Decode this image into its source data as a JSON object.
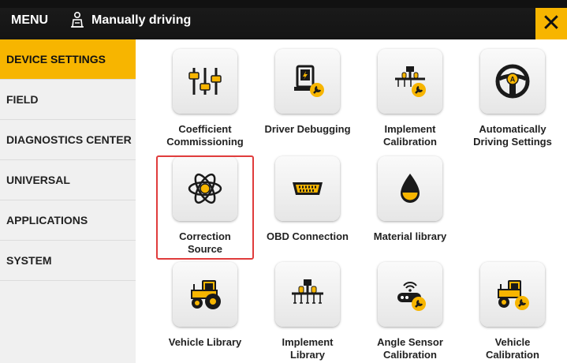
{
  "header": {
    "menu_label": "MENU",
    "mode_icon": "tractor-driver-icon",
    "mode_label": "Manually driving",
    "close_icon": "close-icon",
    "close_glyph": "✕"
  },
  "sidebar": {
    "items": [
      {
        "label": "DEVICE SETTINGS",
        "active": true
      },
      {
        "label": "FIELD",
        "active": false
      },
      {
        "label": "DIAGNOSTICS CENTER",
        "active": false
      },
      {
        "label": "UNIVERSAL",
        "active": false
      },
      {
        "label": "APPLICATIONS",
        "active": false
      },
      {
        "label": "SYSTEM",
        "active": false
      }
    ]
  },
  "tiles": [
    {
      "label": "Coefficient\nCommissioning",
      "icon": "sliders-icon"
    },
    {
      "label": "Driver Debugging",
      "icon": "driver-device-icon"
    },
    {
      "label": "Implement\nCalibration",
      "icon": "implement-calibration-icon"
    },
    {
      "label": "Automatically\nDriving Settings",
      "icon": "steering-wheel-icon"
    },
    {
      "label": "Correction\nSource",
      "icon": "atom-icon",
      "highlighted": true
    },
    {
      "label": "OBD Connection",
      "icon": "obd-connector-icon"
    },
    {
      "label": "Material library",
      "icon": "drop-icon"
    },
    {
      "label": "Vehicle Library",
      "icon": "tractor-icon"
    },
    {
      "label": "Implement\nLibrary",
      "icon": "implement-icon"
    },
    {
      "label": "Angle Sensor\nCalibration",
      "icon": "angle-sensor-icon"
    },
    {
      "label": "Vehicle\nCalibration",
      "icon": "tractor-wrench-icon"
    }
  ],
  "colors": {
    "accent": "#f7b500",
    "highlight_border": "#e03c3c",
    "topbar": "#141414"
  }
}
